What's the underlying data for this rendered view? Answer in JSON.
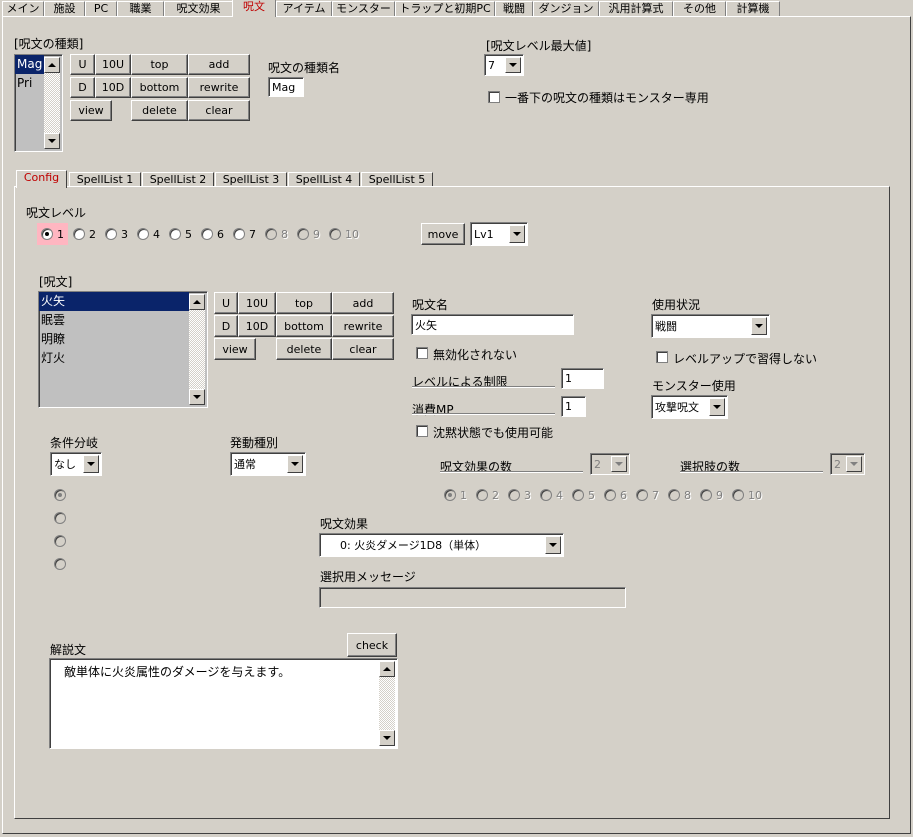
{
  "main_tabs": [
    "メイン",
    "施設",
    "PC",
    "職業",
    "呪文効果",
    "呪文",
    "アイテム",
    "モンスター",
    "トラップと初期PC",
    "戦闘",
    "ダンジョン",
    "汎用計算式",
    "その他",
    "計算機"
  ],
  "spell_type": {
    "group_label": "[呪文の種類]",
    "items": [
      "Mag",
      "Pri"
    ],
    "name_label": "呪文の種類名",
    "name_value": "Mag"
  },
  "top_buttons": {
    "u": "U",
    "u10": "10U",
    "top": "top",
    "add": "add",
    "d": "D",
    "d10": "10D",
    "bottom": "bottom",
    "rewrite": "rewrite",
    "view": "view",
    "delete": "delete",
    "clear": "clear"
  },
  "max_level": {
    "label": "[呪文レベル最大値]",
    "value": "7",
    "monster_only_label": "一番下の呪文の種類はモンスター専用"
  },
  "sub_tabs": [
    "Config",
    "SpellList 1",
    "SpellList 2",
    "SpellList 3",
    "SpellList 4",
    "SpellList 5"
  ],
  "spell_level": {
    "label": "呪文レベル",
    "options": [
      "1",
      "2",
      "3",
      "4",
      "5",
      "6",
      "7",
      "8",
      "9",
      "10"
    ],
    "move_label": "move",
    "move_target": "Lv1"
  },
  "spells": {
    "label": "[呪文]",
    "items": [
      "火矢",
      "眠雲",
      "明瞭",
      "灯火"
    ]
  },
  "spell_buttons": {
    "u": "U",
    "u10": "10U",
    "top": "top",
    "add": "add",
    "d": "D",
    "d10": "10D",
    "bottom": "bottom",
    "rewrite": "rewrite",
    "view": "view",
    "delete": "delete",
    "clear": "clear"
  },
  "spell_detail": {
    "name_label": "呪文名",
    "name_value": "火矢",
    "not_nullified_label": "無効化されない",
    "level_limit_label": "レベルによる制限",
    "level_limit_value": "1",
    "mp_label": "消費MP",
    "mp_value": "1",
    "silence_label": "沈黙状態でも使用可能",
    "usage_label": "使用状況",
    "usage_value": "戦闘",
    "no_levelup_label": "レベルアップで習得しない",
    "monster_use_label": "モンスター使用",
    "monster_use_value": "攻撃呪文"
  },
  "branch": {
    "label": "条件分岐",
    "value": "なし"
  },
  "trigger": {
    "label": "発動種別",
    "value": "通常"
  },
  "effect_count": {
    "label": "呪文効果の数",
    "value": "2"
  },
  "choice_count": {
    "label": "選択肢の数",
    "value": "2"
  },
  "effect_radios": [
    "1",
    "2",
    "3",
    "4",
    "5",
    "6",
    "7",
    "8",
    "9",
    "10"
  ],
  "effect": {
    "label": "呪文効果",
    "value": "0: 火炎ダメージ1D8（単体）"
  },
  "select_message": {
    "label": "選択用メッセージ",
    "value": ""
  },
  "description": {
    "label": "解説文",
    "check_label": "check",
    "text": "敵単体に火炎属性のダメージを与えます。"
  }
}
